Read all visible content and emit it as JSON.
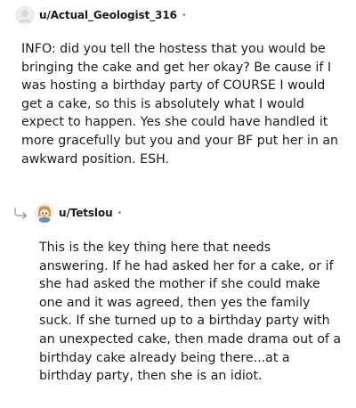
{
  "comments": [
    {
      "username": "u/Actual_Geologist_316",
      "separator": "•",
      "avatar_icon": "default-avatar-icon",
      "text": "INFO: did you tell the hostess that you would be bringing the cake and get her okay? Be cause if I was hosting a birthday party of COURSE I would get a cake, so this is absolutely what I would expect to happen. Yes she could have handled it more gracefully but you and your BF put her in an awkward position. ESH."
    },
    {
      "username": "u/Tetslou",
      "separator": "•",
      "avatar_icon": "character-avatar-icon",
      "reply_icon": "reply-arrow-icon",
      "text": "This is the key thing here that needs answering. If he had asked her for a cake, or if she had asked the mother if she could make one and it was agreed, then yes the family suck. If she turned up to a birthday party with an unexpected cake, then made drama out of a birthday cake already being there...at a birthday party, then she is an idiot."
    }
  ],
  "colors": {
    "text": "#1c1c1c",
    "meta": "#878a8c",
    "avatar_bg": "#edeff1"
  }
}
